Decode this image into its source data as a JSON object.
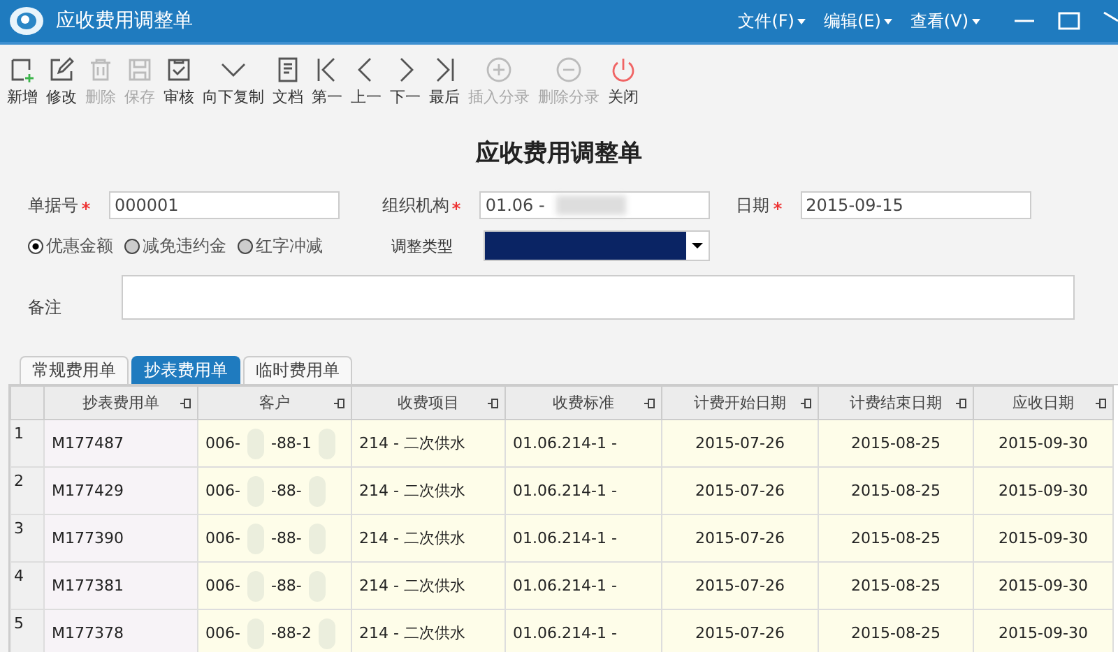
{
  "window": {
    "title": "应收费用调整单"
  },
  "menus": [
    {
      "label": "文件(F)"
    },
    {
      "label": "编辑(E)"
    },
    {
      "label": "查看(V)"
    }
  ],
  "toolbar": [
    {
      "label": "新增",
      "kind": "new",
      "disabled": false
    },
    {
      "label": "修改",
      "kind": "edit",
      "disabled": false
    },
    {
      "label": "删除",
      "kind": "delete",
      "disabled": true
    },
    {
      "label": "保存",
      "kind": "save",
      "disabled": true
    },
    {
      "label": "审核",
      "kind": "approve",
      "disabled": false
    },
    {
      "label": "向下复制",
      "kind": "copydown",
      "disabled": false
    },
    {
      "label": "文档",
      "kind": "doc",
      "disabled": false
    },
    {
      "label": "第一",
      "kind": "first",
      "disabled": false
    },
    {
      "label": "上一",
      "kind": "prev",
      "disabled": false
    },
    {
      "label": "下一",
      "kind": "next",
      "disabled": false
    },
    {
      "label": "最后",
      "kind": "last",
      "disabled": false
    },
    {
      "label": "插入分录",
      "kind": "insert",
      "disabled": true
    },
    {
      "label": "删除分录",
      "kind": "remove",
      "disabled": true
    },
    {
      "label": "关闭",
      "kind": "power",
      "disabled": false
    }
  ],
  "form": {
    "title": "应收费用调整单",
    "fields": [
      {
        "label": "单据号",
        "required": true,
        "value": "000001",
        "blurred": false
      },
      {
        "label": "组织机构",
        "required": true,
        "value": "01.06 -",
        "blurred": true
      },
      {
        "label": "日期",
        "required": true,
        "value": "2015-09-15",
        "blurred": false
      }
    ],
    "radios": [
      {
        "label": "优惠金额",
        "selected": true
      },
      {
        "label": "减免违约金",
        "selected": false
      },
      {
        "label": "红字冲减",
        "selected": false
      }
    ],
    "adjust_type": {
      "label": "调整类型"
    },
    "remark": {
      "label": "备注"
    }
  },
  "tabs": [
    {
      "label": "常规费用单",
      "selected": false
    },
    {
      "label": "抄表费用单",
      "selected": true
    },
    {
      "label": "临时费用单",
      "selected": false
    }
  ],
  "table": {
    "columns": [
      "抄表费用单",
      "客户",
      "收费项目",
      "收费标准",
      "计费开始日期",
      "计费结束日期",
      "应收日期"
    ],
    "rows": [
      {
        "index": "1",
        "bill": "M177487",
        "customer_start": "006-",
        "customer_mid": "-88-1",
        "item": "214 - 二次供水",
        "standard": "01.06.214-1 -",
        "start": "2015-07-26",
        "end": "2015-08-25",
        "due": "2015-09-30"
      },
      {
        "index": "2",
        "bill": "M177429",
        "customer_start": "006-",
        "customer_mid": "-88-",
        "item": "214 - 二次供水",
        "standard": "01.06.214-1 -",
        "start": "2015-07-26",
        "end": "2015-08-25",
        "due": "2015-09-30"
      },
      {
        "index": "3",
        "bill": "M177390",
        "customer_start": "006-",
        "customer_mid": "-88-",
        "item": "214 - 二次供水",
        "standard": "01.06.214-1 -",
        "start": "2015-07-26",
        "end": "2015-08-25",
        "due": "2015-09-30"
      },
      {
        "index": "4",
        "bill": "M177381",
        "customer_start": "006-",
        "customer_mid": "-88-",
        "item": "214 - 二次供水",
        "standard": "01.06.214-1 -",
        "start": "2015-07-26",
        "end": "2015-08-25",
        "due": "2015-09-30"
      },
      {
        "index": "5",
        "bill": "M177378",
        "customer_start": "006-",
        "customer_mid": "-88-2",
        "item": "214 - 二次供水",
        "standard": "01.06.214-1 -",
        "start": "2015-07-26",
        "end": "2015-08-25",
        "due": "2015-09-30"
      }
    ]
  }
}
